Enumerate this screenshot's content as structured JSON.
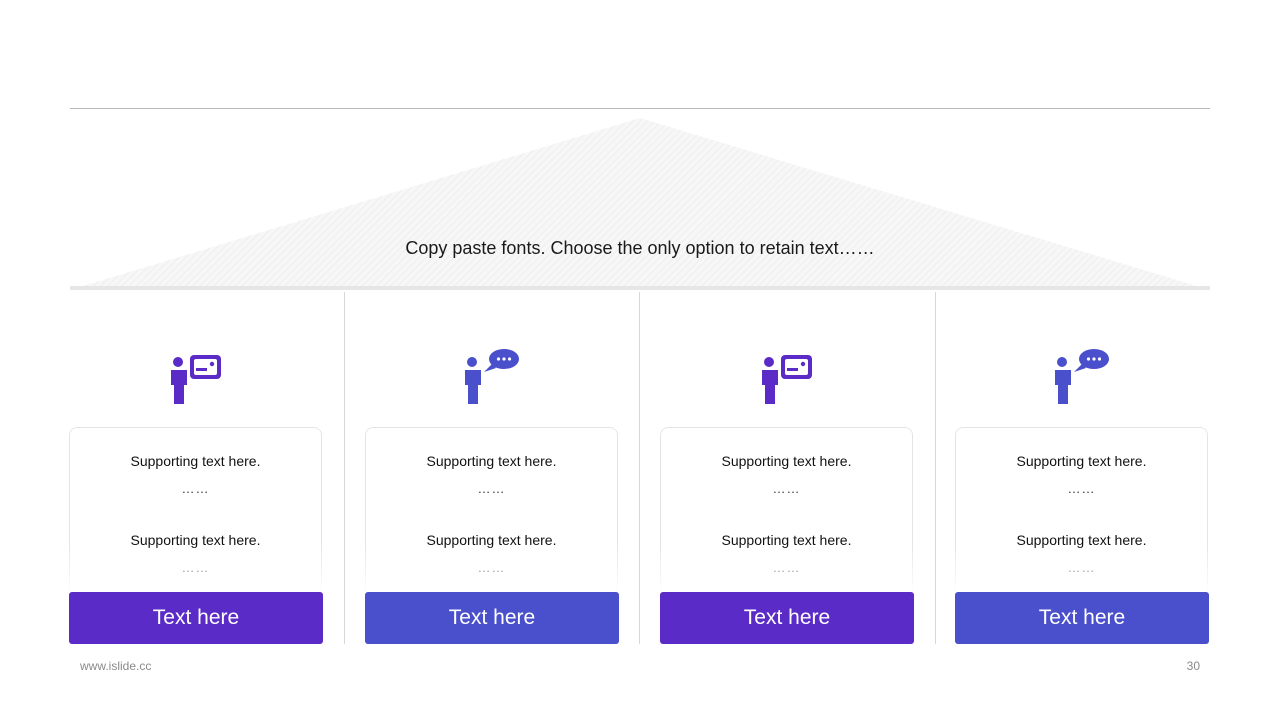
{
  "roof": {
    "text": "Copy paste fonts. Choose the only option to retain text……"
  },
  "columns": [
    {
      "icon": "presenter-board-icon",
      "line1": "Supporting text here.",
      "dots1": "……",
      "line2": "Supporting text here.",
      "dots2": "……",
      "button": "Text here",
      "color": "#5b2bc8"
    },
    {
      "icon": "speaker-bubble-icon",
      "line1": "Supporting text here.",
      "dots1": "……",
      "line2": "Supporting text here.",
      "dots2": "……",
      "button": "Text here",
      "color": "#4a4fcb"
    },
    {
      "icon": "presenter-board-icon",
      "line1": "Supporting text here.",
      "dots1": "……",
      "line2": "Supporting text here.",
      "dots2": "……",
      "button": "Text here",
      "color": "#5b2bc8"
    },
    {
      "icon": "speaker-bubble-icon",
      "line1": "Supporting text here.",
      "dots1": "……",
      "line2": "Supporting text here.",
      "dots2": "……",
      "button": "Text here",
      "color": "#4a4fcb"
    }
  ],
  "footer": {
    "website": "www.islide.cc",
    "page": "30"
  }
}
